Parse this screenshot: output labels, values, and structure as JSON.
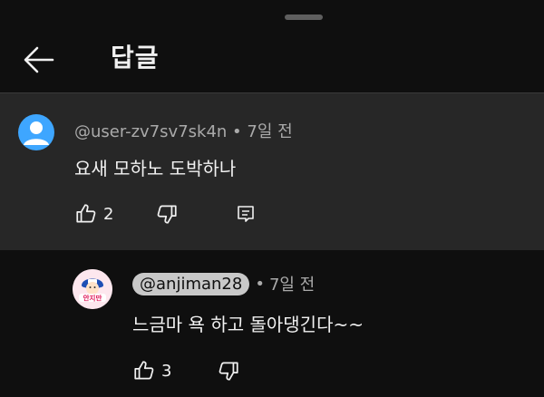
{
  "header": {
    "title": "답글"
  },
  "parent_comment": {
    "author": "@user-zv7sv7sk4n",
    "separator": "•",
    "time": "7일 전",
    "text": "요새 모하노 도박하나",
    "like_count": "2"
  },
  "reply": {
    "author": "@anjiman28",
    "separator": "•",
    "time": "7일 전",
    "text": "느금마 욕 하고 돌아댕긴다~~",
    "like_count": "3",
    "avatar_text": "안지만"
  },
  "colors": {
    "background": "#0f0f0f",
    "highlight": "#272727",
    "default_avatar": "#3ea6ff",
    "secondary_text": "#aaaaaa"
  },
  "icons": [
    "back-arrow-icon",
    "default-avatar-icon",
    "thumbs-up-icon",
    "thumbs-down-icon",
    "reply-icon"
  ]
}
